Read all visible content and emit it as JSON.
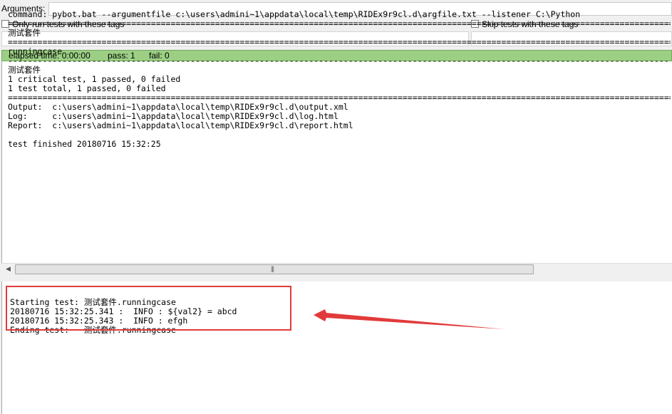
{
  "arguments": {
    "label": "Arguments:",
    "value": ""
  },
  "include_tags": {
    "label": "Only run tests with these tags",
    "value": ""
  },
  "exclude_tags": {
    "label": "Skip tests with these tags",
    "value": ""
  },
  "status": {
    "elapsed": "elapsed time: 0:00:00",
    "pass": "pass: 1",
    "fail": "fail: 0",
    "color": "#9ccf84"
  },
  "console": {
    "command": "command: pybot.bat --argumentfile c:\\users\\admini~1\\appdata\\local\\temp\\RIDEx9r9cl.d\\argfile.txt --listener C:\\Python",
    "sep_double": "==============================================================================================================================================",
    "sep_single": "----------------------------------------------------------------------------------------------------------------------------------------------",
    "suite_name": "测试套件",
    "test_name": "runningcase",
    "suite_footer_name": "测试套件",
    "critical_summary": "1 critical test, 1 passed, 0 failed",
    "total_summary": "1 test total, 1 passed, 0 failed",
    "output_line": "Output:  c:\\users\\admini~1\\appdata\\local\\temp\\RIDEx9r9cl.d\\output.xml",
    "log_line": "Log:     c:\\users\\admini~1\\appdata\\local\\temp\\RIDEx9r9cl.d\\log.html",
    "report_line": "Report:  c:\\users\\admini~1\\appdata\\local\\temp\\RIDEx9r9cl.d\\report.html",
    "finished": "test finished 20180716 15:32:25"
  },
  "log": {
    "lines": [
      "Starting test: 测试套件.runningcase",
      "20180716 15:32:25.341 :  INFO : ${val2} = abcd",
      "20180716 15:32:25.343 :  INFO : efgh",
      "Ending test:   测试套件.runningcase"
    ],
    "highlight_color": "#e23a3a"
  }
}
